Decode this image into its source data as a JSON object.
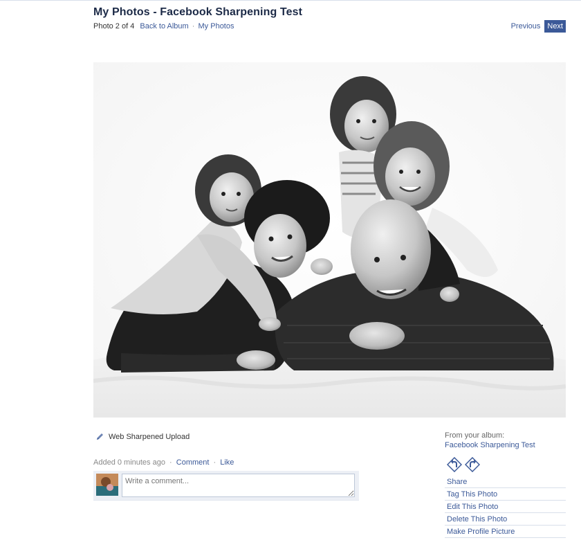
{
  "header": {
    "title": "My Photos - Facebook Sharpening Test",
    "photo_count": "Photo 2 of 4",
    "back_to_album": "Back to Album",
    "separator": "·",
    "my_photos": "My Photos"
  },
  "pager": {
    "previous": "Previous",
    "next": "Next"
  },
  "photo": {
    "alt": "Black and white family portrait"
  },
  "caption": {
    "text": "Web Sharpened Upload"
  },
  "meta": {
    "added": "Added 0 minutes ago",
    "separator": "·",
    "comment": "Comment",
    "like": "Like"
  },
  "comment_form": {
    "placeholder": "Write a comment..."
  },
  "sidebar": {
    "from_label": "From your album:",
    "album_name": "Facebook Sharpening Test",
    "actions": [
      {
        "label": "Share"
      },
      {
        "label": "Tag This Photo"
      },
      {
        "label": "Edit This Photo"
      },
      {
        "label": "Delete This Photo"
      },
      {
        "label": "Make Profile Picture"
      }
    ]
  },
  "colors": {
    "brand": "#3b5998",
    "title": "#1c2a47"
  },
  "icons": {
    "caption": "pencil-icon",
    "rotate_left": "rotate-left-icon",
    "rotate_right": "rotate-right-icon"
  }
}
